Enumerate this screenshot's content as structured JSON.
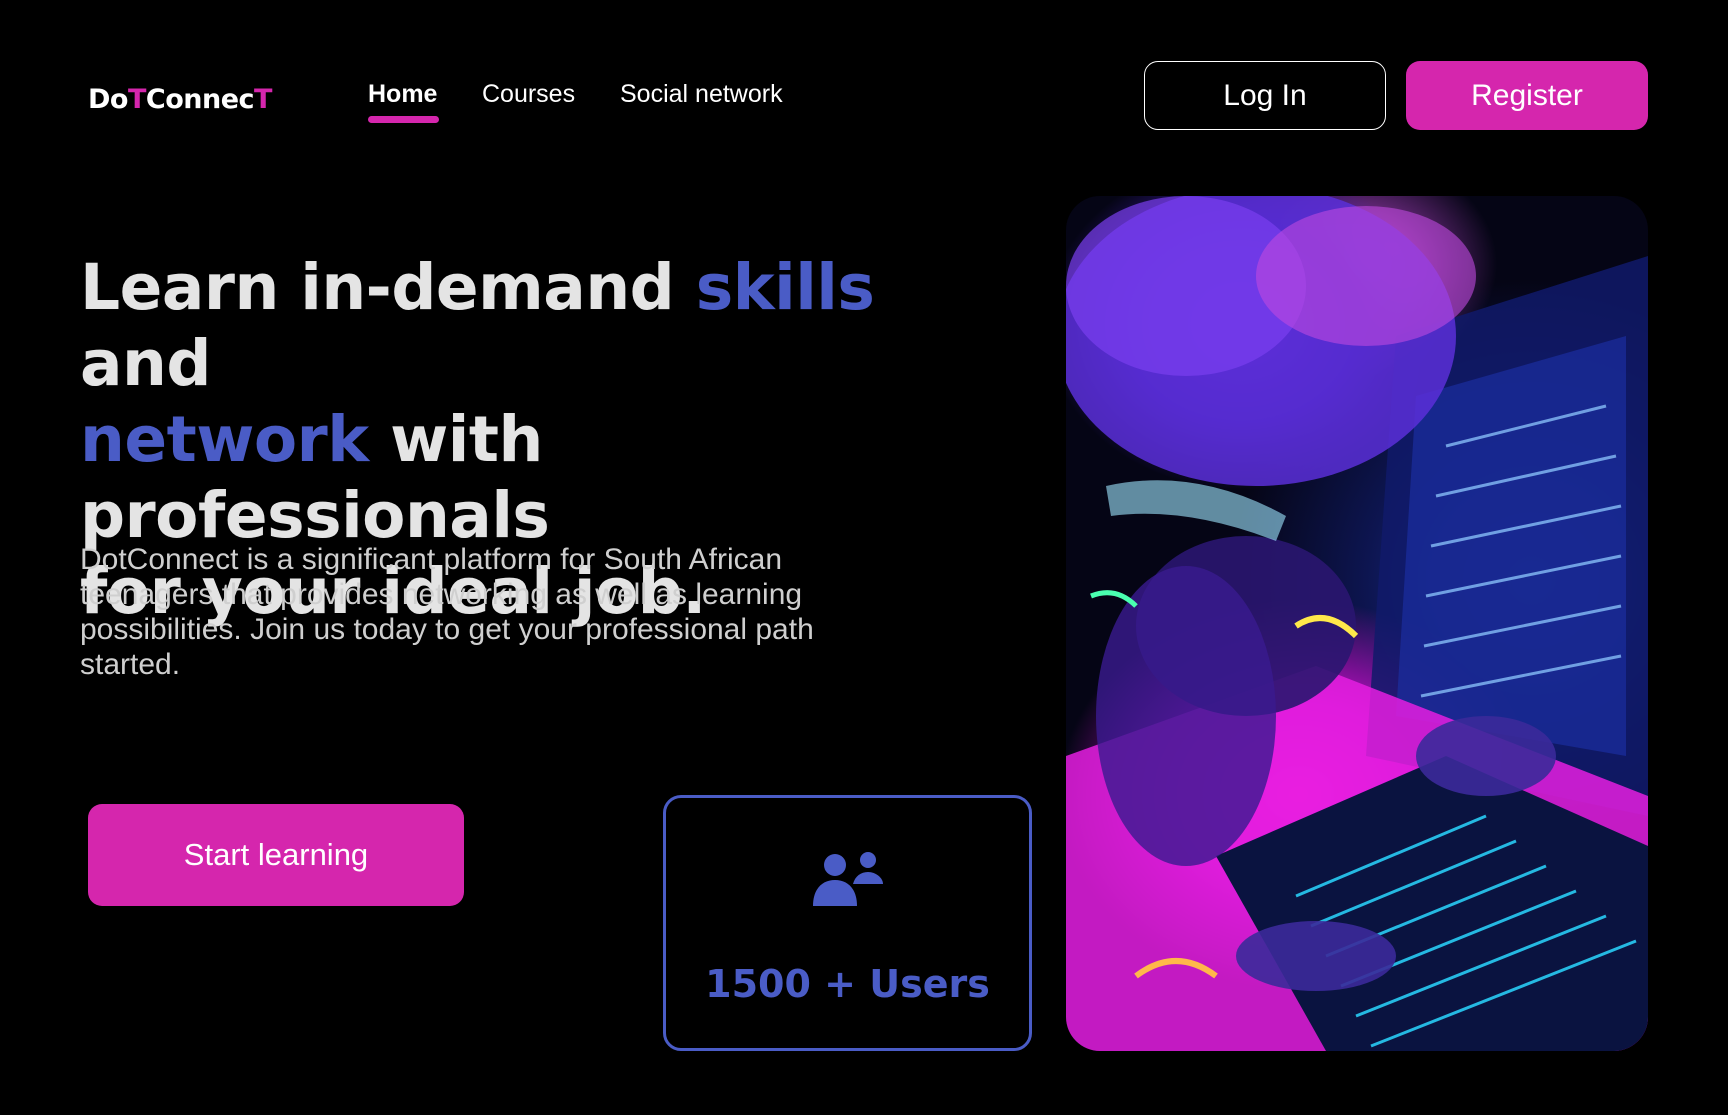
{
  "logo": {
    "part1": "Do",
    "part2": "T",
    "part3": "Connec",
    "part4": "T"
  },
  "nav": {
    "items": [
      {
        "label": "Home",
        "active": true
      },
      {
        "label": "Courses",
        "active": false
      },
      {
        "label": "Social network",
        "active": false
      }
    ]
  },
  "header": {
    "login_label": "Log In",
    "register_label": "Register"
  },
  "hero": {
    "title_part1": "Learn in-demand ",
    "title_accent1": "skills",
    "title_part2": " and",
    "title_accent2": "network",
    "title_part3": " with professionals",
    "title_part4": "for your ideal job.",
    "description": "DotConnect is a significant platform for South African teenagers that provides networking as well as learning possibilities.  Join us today to get your professional path started.",
    "cta_label": "Start learning"
  },
  "stats": {
    "users_label": "1500 + Users",
    "icon": "users-icon"
  },
  "colors": {
    "accent": "#d526ad",
    "secondary": "#4a5cc6",
    "background": "#000000"
  }
}
